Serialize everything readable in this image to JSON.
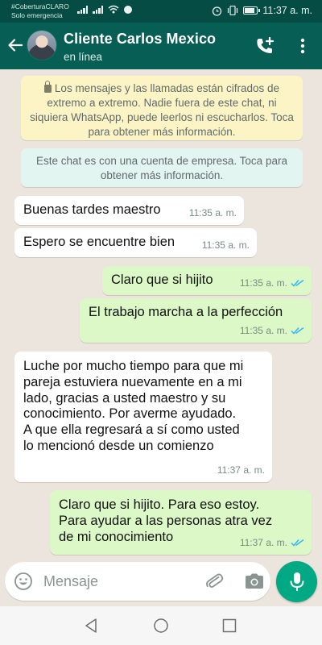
{
  "status_bar": {
    "carrier_line1": "#CoberturaCLARO",
    "carrier_line2": "Solo emergencia",
    "time": "11:37 a. m."
  },
  "header": {
    "contact_name": "Cliente Carlos Mexico",
    "contact_status": "en línea",
    "back_icon": "arrow-back-icon",
    "call_icon": "add-call-icon",
    "menu_icon": "more-vert-icon"
  },
  "system_messages": {
    "encryption": "Los mensajes y las llamadas están cifrados de extremo a extremo. Nadie fuera de este chat, ni siquiera WhatsApp, puede leerlos ni escucharlos. Toca para obtener más información.",
    "business": "Este chat es con una cuenta de empresa. Toca para obtener más información."
  },
  "messages": [
    {
      "direction": "in",
      "text": "Buenas tardes maestro",
      "time": "11:35 a. m."
    },
    {
      "direction": "in",
      "text": "Espero se encuentre bien",
      "time": "11:35 a. m."
    },
    {
      "direction": "out",
      "text": "Claro que si hijito",
      "time": "11:35 a. m.",
      "read": true
    },
    {
      "direction": "out",
      "text": "El trabajo marcha a la perfección",
      "time": "11:35 a. m.",
      "read": true
    },
    {
      "direction": "in",
      "text": "Luche por mucho tiempo para que mi\npareja estuviera nuevamente en a mi\nlado, gracias a usted maestro y su\nconocimiento. Por averme ayudado.\nA que ella regresará a sí como usted\nlo mencionó desde un comienzo",
      "time": "11:37 a. m."
    },
    {
      "direction": "out",
      "text": "Claro que si hijito. Para eso estoy.\nPara ayudar a las personas atra vez\nde mi conocimiento",
      "time": "11:37 a. m.",
      "read": true
    }
  ],
  "input": {
    "placeholder": "Mensaje",
    "icons": [
      "emoji-icon",
      "attach-icon",
      "camera-icon",
      "mic-icon"
    ]
  },
  "colors": {
    "header": "#075e54",
    "status_bar": "#054d44",
    "outgoing_bubble": "#dcf8c6",
    "incoming_bubble": "#ffffff",
    "read_ticks": "#34b7f1",
    "mic_button": "#00a884"
  }
}
